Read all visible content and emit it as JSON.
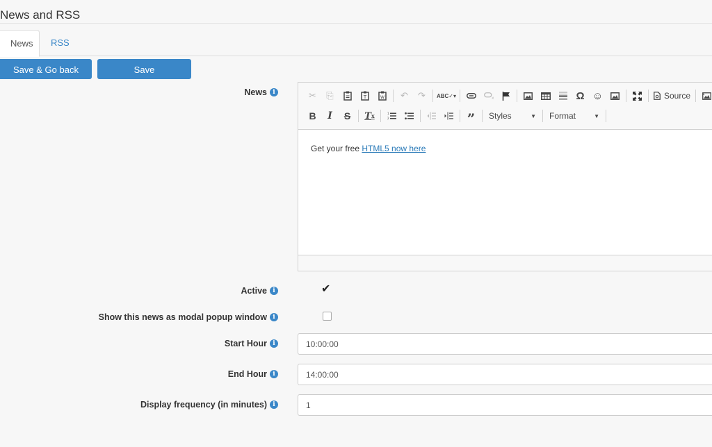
{
  "page": {
    "title": "News and RSS"
  },
  "tabs": [
    {
      "label": "News",
      "active": true
    },
    {
      "label": "RSS",
      "active": false
    }
  ],
  "actions": {
    "save_back_label": "Save & Go back",
    "save_label": "Save"
  },
  "colors": {
    "accent": "#3a87c8",
    "background": "#f7f7f7",
    "link": "#2a7ab8"
  },
  "form": {
    "news": {
      "label": "News",
      "info_icon": "info-circle-icon",
      "editor": {
        "toolbar_row1": [
          {
            "icon": "cut-icon",
            "glyph": "✂",
            "disabled": true
          },
          {
            "icon": "copy-icon",
            "glyph": "⎘",
            "disabled": true
          },
          {
            "icon": "paste-icon",
            "glyph": "📋",
            "disabled": false
          },
          {
            "icon": "paste-text-icon",
            "glyph": "T",
            "disabled": false
          },
          {
            "icon": "paste-word-icon",
            "glyph": "W",
            "disabled": false
          },
          {
            "icon": "undo-icon",
            "glyph": "↶",
            "disabled": true
          },
          {
            "icon": "redo-icon",
            "glyph": "↷",
            "disabled": true
          },
          {
            "icon": "spellcheck-icon",
            "glyph": "ABC✓",
            "disabled": false
          },
          {
            "icon": "link-icon",
            "glyph": "⛓",
            "disabled": false
          },
          {
            "icon": "unlink-icon",
            "glyph": "⛓",
            "disabled": true
          },
          {
            "icon": "anchor-icon",
            "glyph": "⚑",
            "disabled": false
          },
          {
            "icon": "image-icon",
            "glyph": "🖼",
            "disabled": false
          },
          {
            "icon": "table-icon",
            "glyph": "▦",
            "disabled": false
          },
          {
            "icon": "horizontal-line-icon",
            "glyph": "☰",
            "disabled": false
          },
          {
            "icon": "special-char-icon",
            "glyph": "Ω",
            "disabled": false
          },
          {
            "icon": "smiley-icon",
            "glyph": "☺",
            "disabled": false
          },
          {
            "icon": "image2-icon",
            "glyph": "🖼",
            "disabled": false
          },
          {
            "icon": "maximize-icon",
            "glyph": "⤢",
            "disabled": false
          }
        ],
        "source_label": "Source",
        "toolbar_row2": [
          {
            "icon": "bold-icon",
            "glyph": "B"
          },
          {
            "icon": "italic-icon",
            "glyph": "I"
          },
          {
            "icon": "strikethrough-icon",
            "glyph": "S"
          },
          {
            "icon": "remove-format-icon",
            "glyph": "Tx"
          },
          {
            "icon": "numbered-list-icon",
            "glyph": "≔"
          },
          {
            "icon": "bulleted-list-icon",
            "glyph": "☷"
          },
          {
            "icon": "outdent-icon",
            "glyph": "⇤"
          },
          {
            "icon": "indent-icon",
            "glyph": "⇥"
          },
          {
            "icon": "blockquote-icon",
            "glyph": "❞"
          }
        ],
        "styles_label": "Styles",
        "format_label": "Format",
        "content_text": "Get your free ",
        "content_link": "HTML5 now here "
      }
    },
    "active": {
      "label": "Active",
      "checked": true
    },
    "modal_popup": {
      "label": "Show this news as modal popup window",
      "checked": false
    },
    "start_hour": {
      "label": "Start Hour",
      "value": "10:00:00"
    },
    "end_hour": {
      "label": "End Hour",
      "value": "14:00:00"
    },
    "display_frequency": {
      "label": "Display frequency (in minutes)",
      "value": "1"
    }
  }
}
